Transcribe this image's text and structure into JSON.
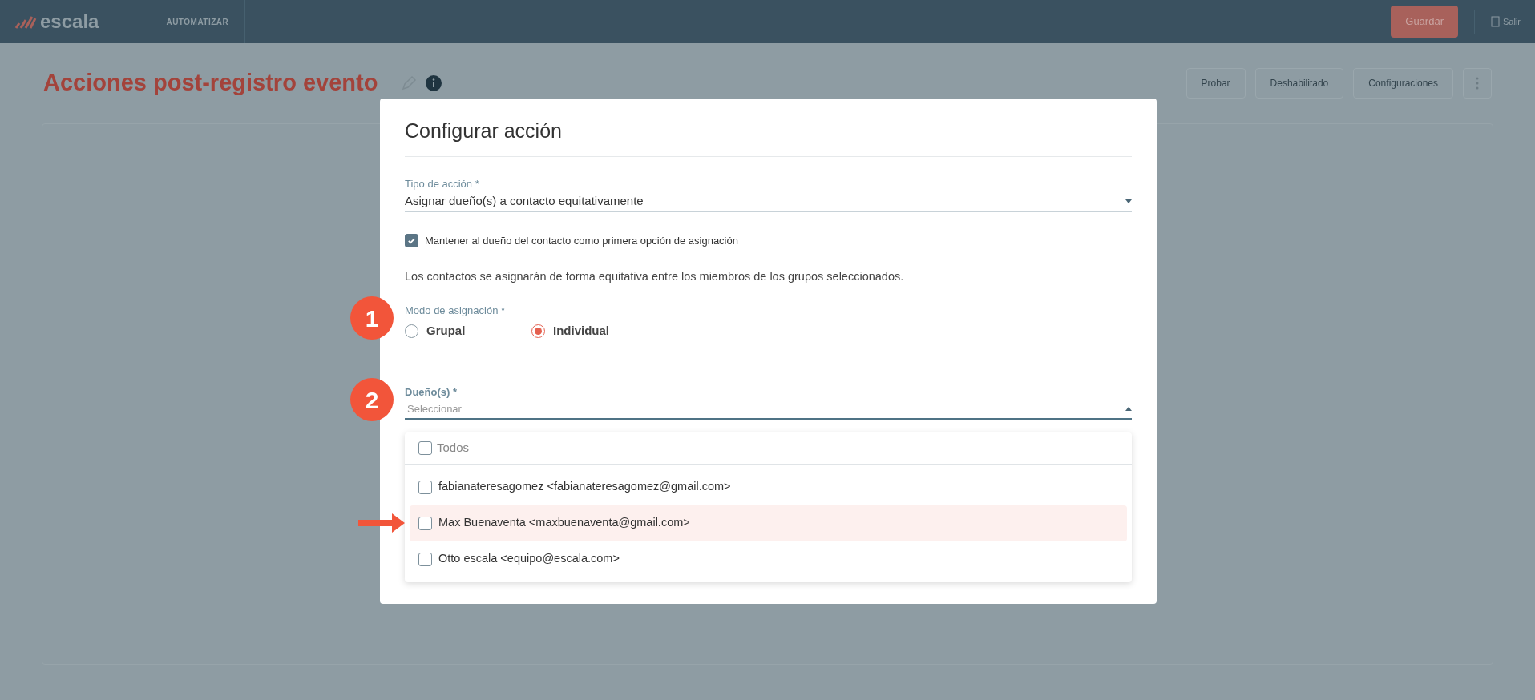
{
  "header": {
    "logo": "escala",
    "nav": "AUTOMATIZAR",
    "save_button": "Guardar",
    "exit": "Salir"
  },
  "page": {
    "title": "Acciones post-registro evento",
    "actions": [
      "Probar",
      "Deshabilitado",
      "Configuraciones"
    ]
  },
  "dialog": {
    "title": "Configurar acción",
    "action_type": {
      "label": "Tipo de acción *",
      "value": "Asignar dueño(s) a contacto equitativamente"
    },
    "keep_owner": {
      "label": "Mantener al dueño del contacto como primera opción de asignación",
      "checked": true
    },
    "description": "Los contactos se asignarán de forma equitativa entre los miembros de los grupos seleccionados.",
    "mode": {
      "label": "Modo de asignación *",
      "badge": "1",
      "options": [
        {
          "label": "Grupal",
          "selected": false
        },
        {
          "label": "Individual",
          "selected": true
        }
      ]
    },
    "owners": {
      "label": "Dueño(s) *",
      "badge": "2",
      "placeholder": "Seleccionar",
      "expanded": true,
      "select_all": {
        "label": "Todos",
        "checked": false
      },
      "options": [
        {
          "label": "fabianateresagomez <fabianateresagomez@gmail.com>",
          "checked": false,
          "highlighted": false,
          "arrow": false
        },
        {
          "label": "Max Buenaventa <maxbuenaventa@gmail.com>",
          "checked": false,
          "highlighted": true,
          "arrow": true
        },
        {
          "label": "Otto escala <equipo@escala.com>",
          "checked": false,
          "highlighted": false,
          "arrow": false
        }
      ]
    }
  }
}
